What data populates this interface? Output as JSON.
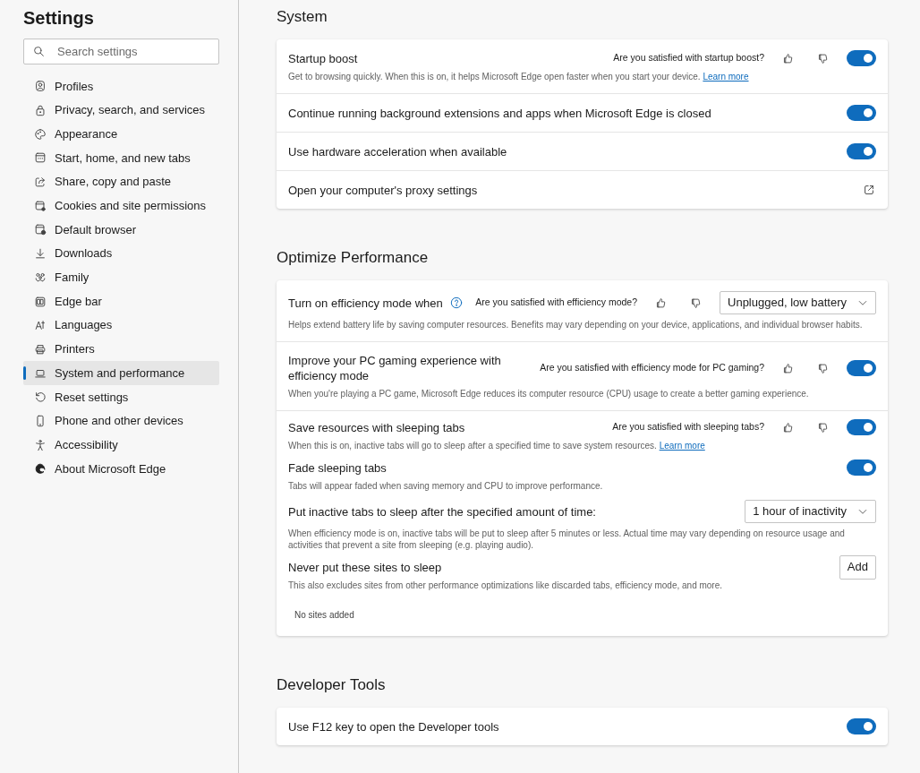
{
  "sidebar": {
    "title": "Settings",
    "search": {
      "placeholder": "Search settings"
    },
    "items": [
      {
        "label": "Profiles",
        "selected": false
      },
      {
        "label": "Privacy, search, and services",
        "selected": false
      },
      {
        "label": "Appearance",
        "selected": false
      },
      {
        "label": "Start, home, and new tabs",
        "selected": false
      },
      {
        "label": "Share, copy and paste",
        "selected": false
      },
      {
        "label": "Cookies and site permissions",
        "selected": false
      },
      {
        "label": "Default browser",
        "selected": false
      },
      {
        "label": "Downloads",
        "selected": false
      },
      {
        "label": "Family",
        "selected": false
      },
      {
        "label": "Edge bar",
        "selected": false
      },
      {
        "label": "Languages",
        "selected": false
      },
      {
        "label": "Printers",
        "selected": false
      },
      {
        "label": "System and performance",
        "selected": true
      },
      {
        "label": "Reset settings",
        "selected": false
      },
      {
        "label": "Phone and other devices",
        "selected": false
      },
      {
        "label": "Accessibility",
        "selected": false
      },
      {
        "label": "About Microsoft Edge",
        "selected": false
      }
    ]
  },
  "sections": [
    {
      "title": "System",
      "rows": [
        {
          "items": [
            {
              "kind": "toggle",
              "label": "Startup boost",
              "question": "Are you satisfied with startup boost?",
              "description": "Get to browsing quickly. When this is on, it helps Microsoft Edge open faster when you start your device.",
              "link": "Learn more",
              "on": true
            }
          ]
        },
        {
          "items": [
            {
              "kind": "toggle",
              "label": "Continue running background extensions and apps when Microsoft Edge is closed",
              "on": true
            }
          ]
        },
        {
          "items": [
            {
              "kind": "toggle",
              "label": "Use hardware acceleration when available",
              "on": true
            }
          ]
        },
        {
          "items": [
            {
              "kind": "external",
              "label": "Open your computer's proxy settings"
            }
          ]
        }
      ]
    },
    {
      "title": "Optimize Performance",
      "rows": [
        {
          "items": [
            {
              "kind": "dropdown",
              "label": "Turn on efficiency mode when",
              "help": true,
              "question": "Are you satisfied with efficiency mode?",
              "value": "Unplugged, low battery",
              "description": "Helps extend battery life by saving computer resources. Benefits may vary depending on your device, applications, and individual browser habits."
            }
          ]
        },
        {
          "items": [
            {
              "kind": "toggle",
              "label": "Improve your PC gaming experience with efficiency mode",
              "question": "Are you satisfied with efficiency mode for PC gaming?",
              "on": true,
              "description": "When you're playing a PC game, Microsoft Edge reduces its computer resource (CPU) usage to create a better gaming experience."
            }
          ]
        },
        {
          "items": [
            {
              "kind": "toggle",
              "label": "Save resources with sleeping tabs",
              "question": "Are you satisfied with sleeping tabs?",
              "on": true,
              "description": "When this is on, inactive tabs will go to sleep after a specified time to save system resources.",
              "link": "Learn more"
            },
            {
              "kind": "toggle",
              "label": "Fade sleeping tabs",
              "on": true,
              "description": "Tabs will appear faded when saving memory and CPU to improve performance."
            },
            {
              "kind": "dropdown",
              "label": "Put inactive tabs to sleep after the specified amount of time:",
              "value": "1 hour of inactivity",
              "description": "When efficiency mode is on, inactive tabs will be put to sleep after 5 minutes or less. Actual time may vary depending on resource usage and activities that prevent a site from sleeping (e.g. playing audio)."
            },
            {
              "kind": "button",
              "label": "Never put these sites to sleep",
              "button": "Add",
              "description": "This also excludes sites from other performance optimizations like discarded tabs, efficiency mode, and more.",
              "note": "No sites added"
            }
          ]
        }
      ]
    },
    {
      "title": "Developer Tools",
      "rows": [
        {
          "items": [
            {
              "kind": "toggle",
              "label": "Use F12 key to open the Developer tools",
              "on": true
            }
          ]
        }
      ]
    }
  ]
}
